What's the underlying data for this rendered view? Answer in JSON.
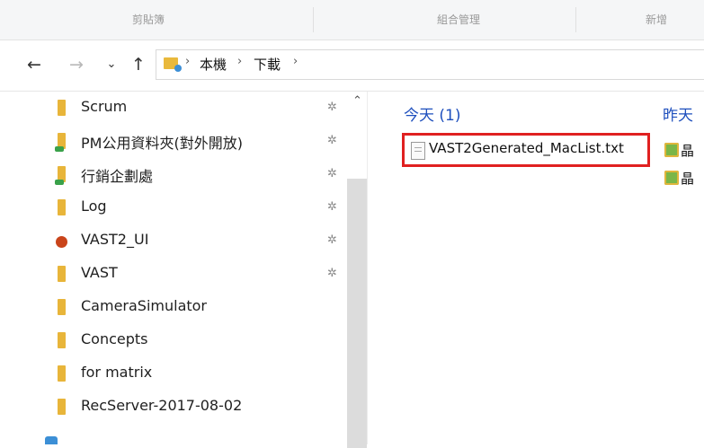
{
  "ribbon": {
    "groups": [
      "剪貼簿",
      "組合管理",
      "新增"
    ]
  },
  "nav": {
    "back_icon": "arrow-left",
    "forward_icon": "arrow-right",
    "recent_icon": "chevron-down",
    "up_icon": "arrow-up",
    "breadcrumb": [
      "本機",
      "下載"
    ]
  },
  "sidebar": {
    "items": [
      {
        "label": "Scrum",
        "pinned": true
      },
      {
        "label": "PM公用資料夾(對外開放)",
        "pinned": true
      },
      {
        "label": "行銷企劃處",
        "pinned": true
      },
      {
        "label": "Log",
        "pinned": true
      },
      {
        "label": "VAST2_UI",
        "pinned": true
      },
      {
        "label": "VAST",
        "pinned": true
      },
      {
        "label": "CameraSimulator",
        "pinned": false
      },
      {
        "label": "Concepts",
        "pinned": false
      },
      {
        "label": "for matrix",
        "pinned": false
      },
      {
        "label": "RecServer-2017-08-02",
        "pinned": false
      }
    ]
  },
  "content": {
    "today_header": "今天 (1)",
    "yesterday_header": "昨天",
    "file_name": "VAST2Generated_MacList.txt",
    "yesterday_items": [
      "晶",
      "晶"
    ]
  },
  "colors": {
    "header_blue": "#1e4fbd",
    "highlight_red": "#e02020",
    "folder_yellow": "#e8b53a"
  }
}
